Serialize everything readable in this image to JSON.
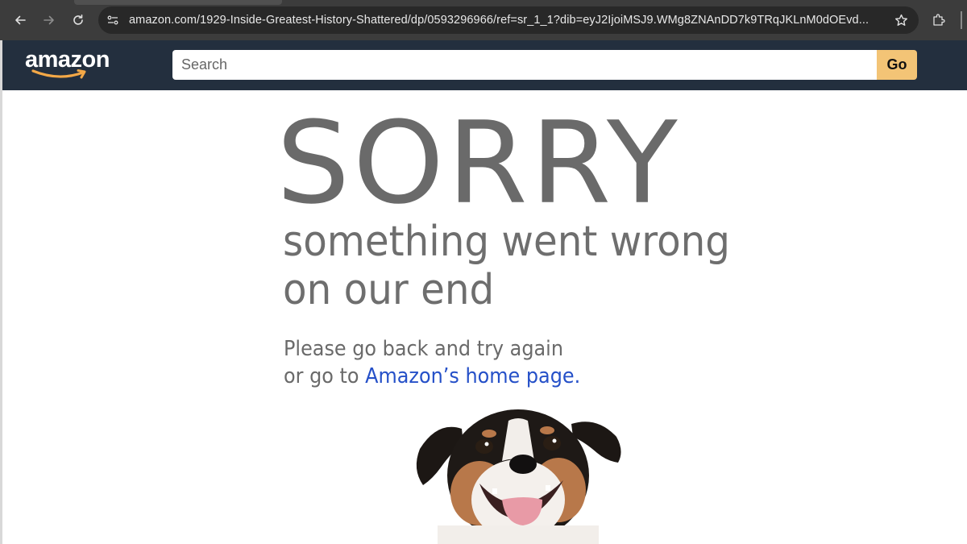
{
  "browser": {
    "url": "amazon.com/1929-Inside-Greatest-History-Shattered/dp/0593296966/ref=sr_1_1?dib=eyJ2IjoiMSJ9.WMg8ZNAnDD7k9TRqJKLnM0dOEvd...",
    "icons": [
      "back-arrow-icon",
      "forward-arrow-icon",
      "reload-icon",
      "site-info-icon",
      "bookmark-star-icon",
      "extensions-icon"
    ]
  },
  "header": {
    "logo_text": "amazon",
    "search_placeholder": "Search",
    "go_label": "Go",
    "colors": {
      "header_bg": "#232f3e",
      "go_bg": "#f3c476",
      "logo_smile": "#f3a847"
    }
  },
  "error": {
    "title": "SORRY",
    "line1": "something went wrong",
    "line2": "on our end",
    "msg_line1": "Please go back and try again",
    "msg_line2_prefix": "or go to ",
    "home_link": "Amazon’s home page.",
    "colors": {
      "text": "#6a6a6a",
      "link": "#2550c8"
    }
  }
}
